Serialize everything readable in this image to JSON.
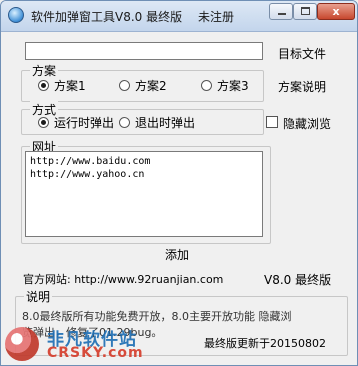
{
  "window": {
    "title": "软件加弹窗工具V8.0 最终版",
    "status": "未注册",
    "min_glyph": "",
    "max_glyph": "",
    "close_glyph": "x"
  },
  "target": {
    "value": "",
    "button_label": "目标文件"
  },
  "scheme": {
    "group_label": "方案",
    "options": [
      "方案1",
      "方案2",
      "方案3"
    ],
    "selected": "方案1",
    "help_label": "方案说明"
  },
  "mode": {
    "group_label": "方式",
    "options": [
      "运行时弹出",
      "退出时弹出"
    ],
    "selected": "运行时弹出",
    "hide_label": "隐藏浏览",
    "hide_checked": false
  },
  "urls": {
    "group_label": "网址",
    "lines": [
      "http://www.baidu.com",
      "http://www.yahoo.cn"
    ]
  },
  "add_button": "添加",
  "footer": {
    "site_label": "官方网站: http://www.92ruanjian.com",
    "version": "V8.0 最终版"
  },
  "notes": {
    "group_label": "说明",
    "line1": "8.0最终版所有功能免费开放，8.0主要开放功能 隐藏浏",
    "line2": "览弹出，修复了01.29bug。",
    "update": "最终版更新于20150802"
  },
  "watermark": {
    "line1": "非凡软件站",
    "line2": "CRSKY.com"
  }
}
